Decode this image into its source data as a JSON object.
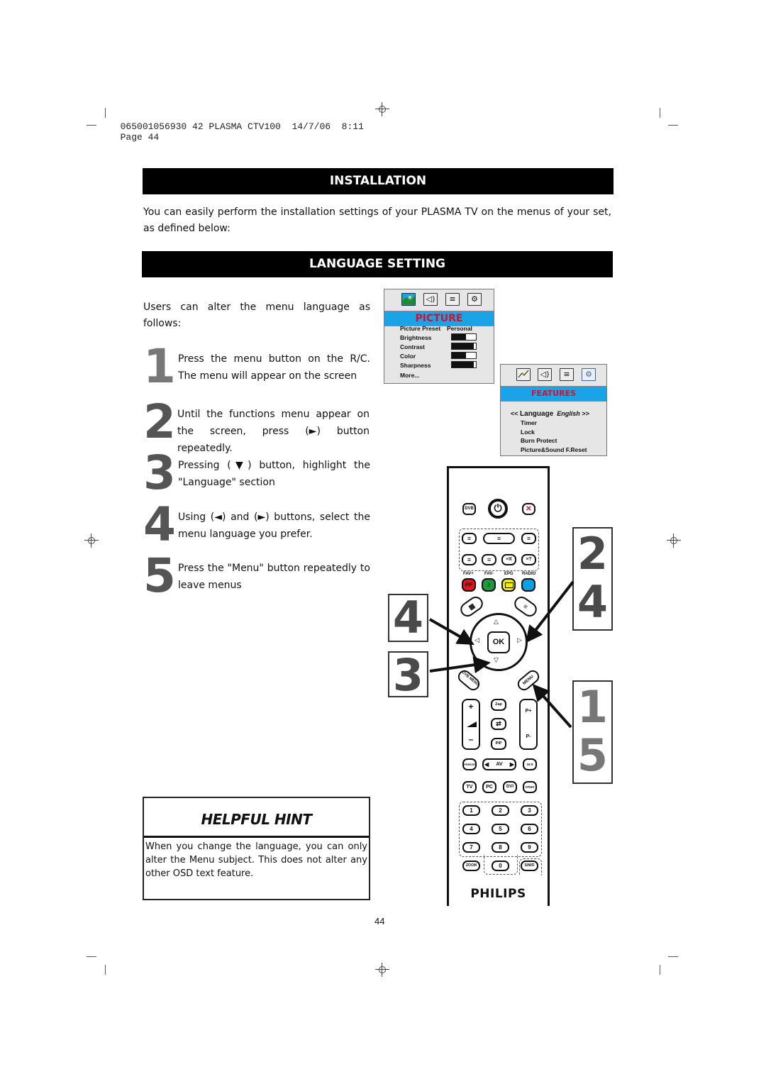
{
  "print_header": {
    "job_text": "065001056930 42 PLASMA CTV100  14/7/06  8:11",
    "page_label": "Page 44"
  },
  "installation": {
    "title": "INSTALLATION",
    "intro": "You can easily  perform the installation settings of your PLASMA TV on the menus of your set, as defined below:"
  },
  "language_setting": {
    "title": "LANGUAGE SETTING",
    "lead": "Users can alter the  menu language as follows:",
    "steps": [
      {
        "num": "1",
        "text": "Press the menu button on the R/C. The menu will appear on the screen"
      },
      {
        "num": "2",
        "text": "Until the functions menu appear on the screen,  press (►) button repeatedly."
      },
      {
        "num": "3",
        "text": "Pressing  (▼)  button,  highlight  the \"Language\" section"
      },
      {
        "num": "4",
        "text": "Using (◄) and (►) buttons, select the menu language you prefer."
      },
      {
        "num": "5",
        "text": "Press the \"Menu\" button repeatedly to leave menus"
      }
    ]
  },
  "helpful_hint": {
    "title": "HELPFUL HINT",
    "text": "When you change the  language, you can only alter the Menu subject. This does not alter any  other OSD text feature."
  },
  "picture_menu": {
    "icons": [
      "picture-icon",
      "sound-icon",
      "list-icon",
      "features-icon"
    ],
    "header": "PICTURE",
    "preset_label": "Picture Preset",
    "preset_value": "Personal",
    "items": [
      {
        "label": "Brightness",
        "level": 0.6
      },
      {
        "label": "Contrast",
        "level": 0.9
      },
      {
        "label": "Color",
        "level": 0.6
      },
      {
        "label": "Sharpness",
        "level": 0.9
      }
    ],
    "more": "More..."
  },
  "features_menu": {
    "icons": [
      "picture-icon",
      "sound-icon",
      "list-icon",
      "features-icon"
    ],
    "header": "FEATURES",
    "language_prefix": "<<",
    "language_label": "Language",
    "language_value": "English",
    "language_suffix": ">>",
    "items": [
      "Timer",
      "Lock",
      "Burn Protect",
      "Picture&Sound F.Reset"
    ]
  },
  "remote": {
    "dvb": "DVB",
    "color_labels": [
      "FAV+",
      "FAV-",
      "EPG",
      "RADIO"
    ],
    "pp": "PP",
    "ok": "OK",
    "dvb_menu": "DVB MENU",
    "menu": "MENU",
    "vol_plus": "+",
    "vol_minus": "–",
    "zap": "Zap",
    "pip": "PIP",
    "p_plus": "P+",
    "p_minus": "P-",
    "freeze": "FREEZE",
    "av": "AV",
    "aspect": "16:9",
    "sources": [
      "TV",
      "PC",
      "DVI",
      "YPbPr"
    ],
    "digits": [
      "1",
      "2",
      "3",
      "4",
      "5",
      "6",
      "7",
      "8",
      "9"
    ],
    "zoom": "ZOOM",
    "zero": "0",
    "smd": "S/M/D",
    "brand": "PHILIPS",
    "colors": {
      "red": "#e8141c",
      "green": "#1a9a3a",
      "yellow": "#f5ec00",
      "blue": "#0aa0e8"
    }
  },
  "callouts": {
    "left_top": "4",
    "left_bottom": "3",
    "right_top": [
      "2",
      "4"
    ],
    "right_bottom": [
      "1",
      "5"
    ]
  },
  "footer": {
    "page_number": "44"
  }
}
